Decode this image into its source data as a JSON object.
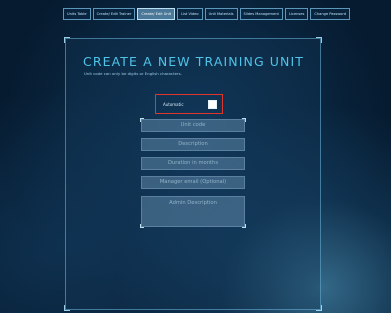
{
  "nav": {
    "tabs": [
      {
        "label": "Units Table"
      },
      {
        "label": "Create/ Edit Trainer"
      },
      {
        "label": "Create/ Edit Unit",
        "active": true
      },
      {
        "label": "List Video"
      },
      {
        "label": "Unit Materials"
      },
      {
        "label": "Slides Management"
      },
      {
        "label": "Licenses"
      },
      {
        "label": "Change Password"
      }
    ]
  },
  "form": {
    "title": "CREATE A NEW TRAINING UNIT",
    "subtitle": "Unit code can only be digits or English characters.",
    "automatic_label": "Automatic",
    "automatic_checked": false,
    "fields": {
      "unit_code": "Unit code",
      "description": "Description",
      "duration": "Duration in months",
      "manager_email": "Manager email (Optional)",
      "admin_description": "Admin Description"
    }
  },
  "colors": {
    "accent": "#4fc3e8",
    "highlight_border": "#e0352b",
    "background": "#07213a"
  }
}
